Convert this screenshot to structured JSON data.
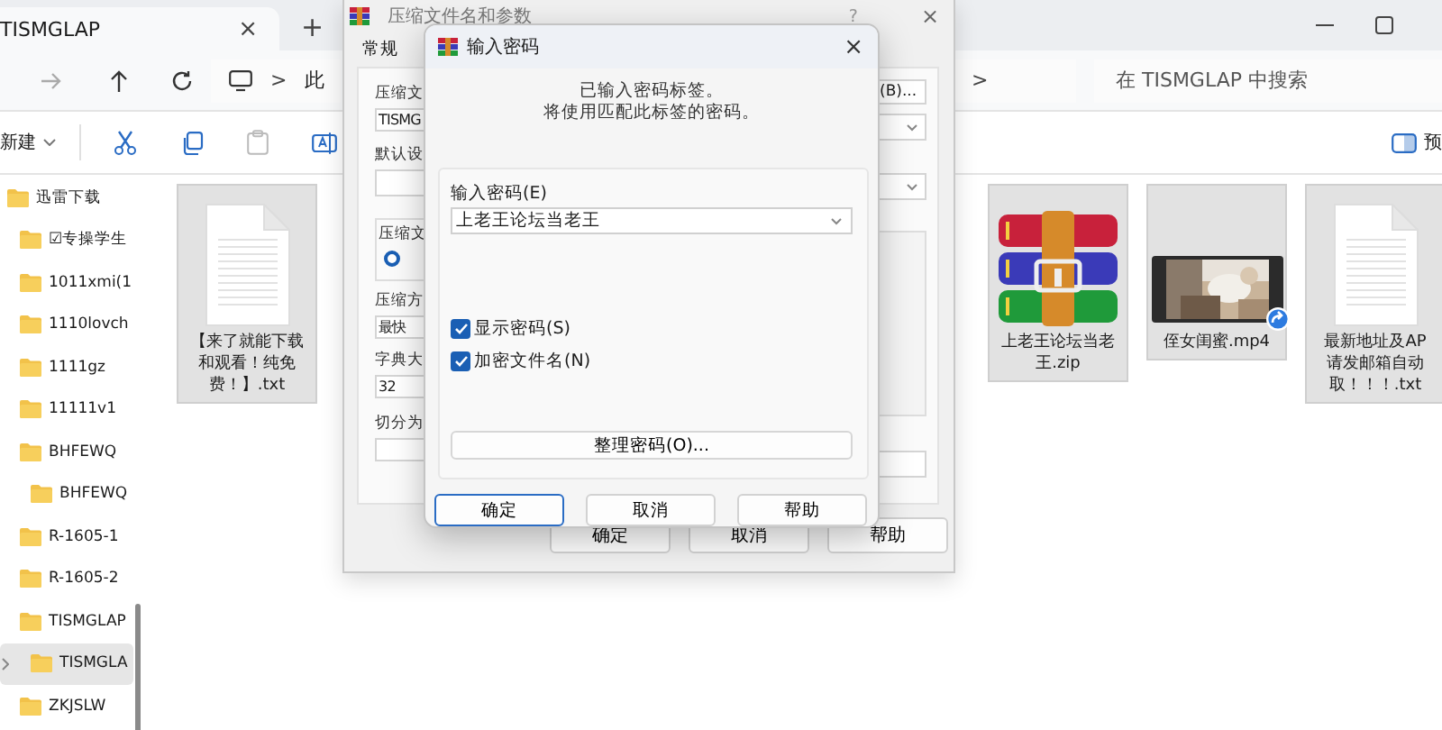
{
  "explorer": {
    "tab": {
      "title": "TISMGLAP",
      "close": "×"
    },
    "new_tab": "+",
    "address": {
      "separator": ">",
      "segment": "此",
      "separator_2": ">"
    },
    "search": {
      "placeholder": "在 TISMGLAP 中搜索"
    },
    "toolbar": {
      "new": "新建",
      "preview": "预"
    },
    "sidebar": {
      "items": [
        {
          "label": "迅雷下载",
          "selected": false,
          "children": [
            {
              "label": "☑专操学生",
              "selected": false
            },
            {
              "label": "1011xmi(1",
              "selected": false
            },
            {
              "label": "1110lovch",
              "selected": false
            },
            {
              "label": "1111gz",
              "selected": false
            },
            {
              "label": "11111v1",
              "selected": false
            },
            {
              "label": "BHFEWQ",
              "selected": false,
              "children": [
                {
                  "label": "BHFEWQ",
                  "selected": false
                }
              ]
            },
            {
              "label": "R-1605-1",
              "selected": false
            },
            {
              "label": "R-1605-2",
              "selected": false
            },
            {
              "label": "TISMGLAP",
              "selected": false,
              "children": [
                {
                  "label": "TISMGLA",
                  "selected": true
                }
              ]
            },
            {
              "label": "ZKJSLW",
              "selected": false
            }
          ]
        }
      ]
    },
    "files": [
      {
        "kind": "text",
        "lines": [
          "【来了就能下载",
          "和观看！纯免",
          "费！】.txt"
        ],
        "selected": true
      },
      {
        "kind": "archive",
        "lines": [
          "上老王论坛当老",
          "王.zip"
        ],
        "selected": true
      },
      {
        "kind": "video",
        "lines": [
          "侄女闺蜜.mp4"
        ],
        "selected": true
      },
      {
        "kind": "text",
        "lines": [
          "最新地址及AP",
          "请发邮箱自动",
          "取！！！.txt"
        ],
        "selected": true
      }
    ]
  },
  "archive_dialog": {
    "title": "压缩文件名和参数",
    "help": "?",
    "close": "×",
    "tab": "常规",
    "left": {
      "name_label": "压缩文",
      "name_value": "TISMG",
      "profile_label": "默认设",
      "format_label": "压缩文",
      "format_radio_selected": true,
      "method_label": "压缩方",
      "method_value": "最快",
      "dict_label": "字典大",
      "dict_value": "32",
      "split_label": "切分为"
    },
    "browse_button": "(B)...",
    "buttons": [
      "确定",
      "取消",
      "帮助"
    ]
  },
  "password_dialog": {
    "title": "输入密码",
    "close": "×",
    "message": [
      "已输入密码标签。",
      "将使用匹配此标签的密码。"
    ],
    "password_label": "输入密码(E)",
    "password_value": "上老王论坛当老王",
    "options": [
      {
        "label": "显示密码(S)",
        "checked": true
      },
      {
        "label": "加密文件名(N)",
        "checked": true
      }
    ],
    "organize_button": "整理密码(O)...",
    "buttons": [
      {
        "label": "确定",
        "default": true
      },
      {
        "label": "取消",
        "default": false
      },
      {
        "label": "帮助",
        "default": false
      }
    ]
  }
}
